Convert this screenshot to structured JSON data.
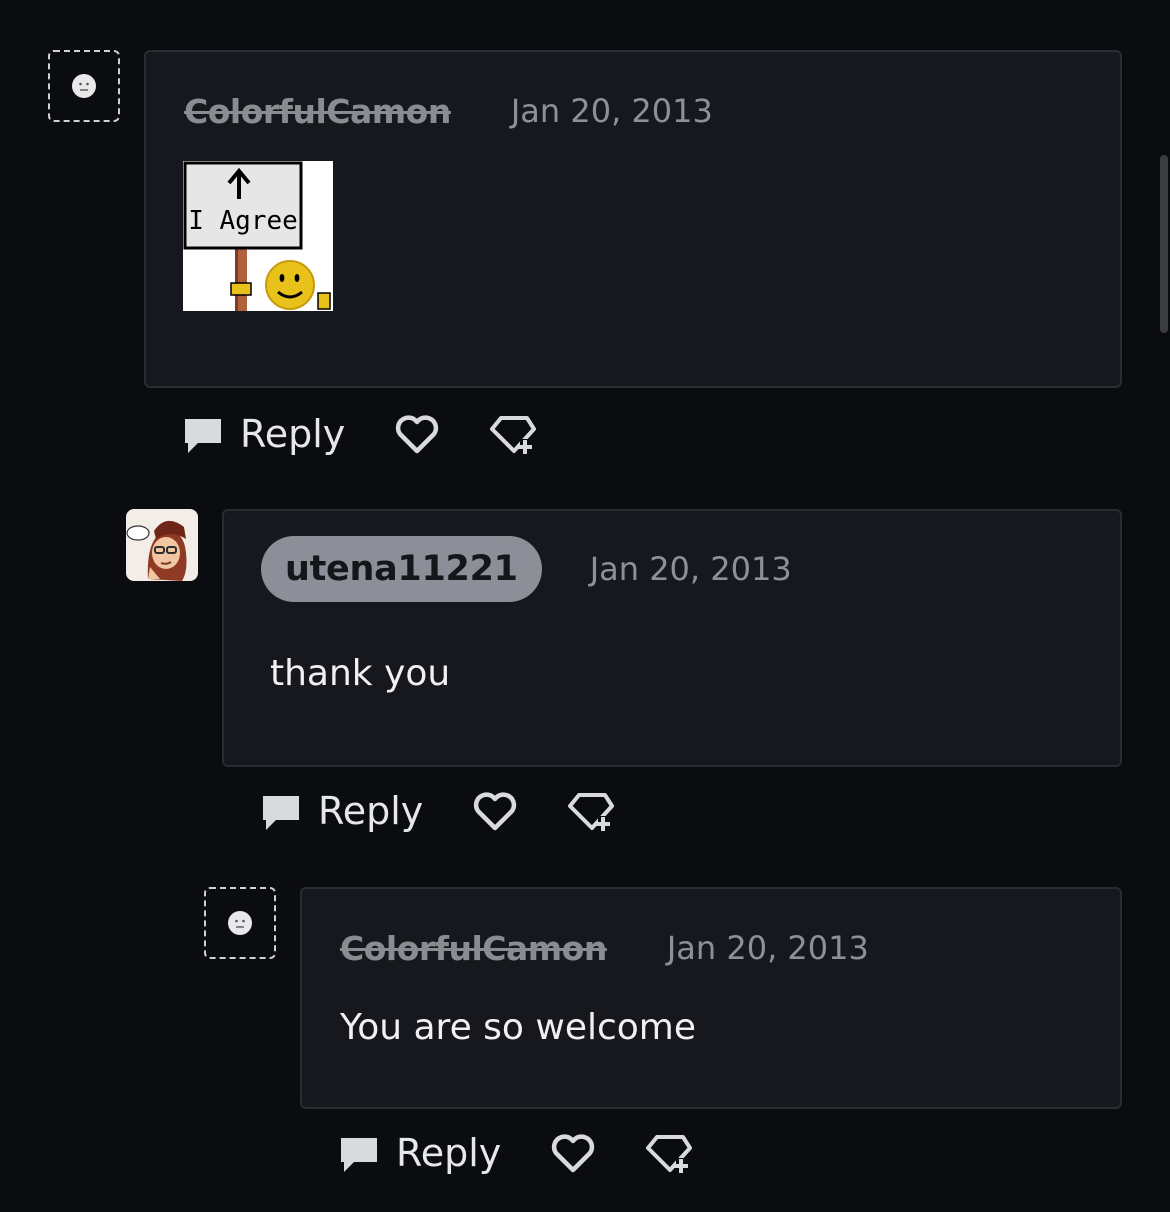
{
  "comments": [
    {
      "username": "ColorfulCamon",
      "date": "Jan 20, 2013",
      "image_sign_text": "I Agree",
      "actions": {
        "reply_label": "Reply"
      }
    },
    {
      "username": "utena11221",
      "date": "Jan 20, 2013",
      "text": "thank you",
      "actions": {
        "reply_label": "Reply"
      }
    },
    {
      "username": "ColorfulCamon",
      "date": "Jan 20, 2013",
      "text": "You are so welcome",
      "actions": {
        "reply_label": "Reply"
      }
    }
  ],
  "icons": {
    "reply": "speech-bubble-icon",
    "like": "heart-icon",
    "award": "gem-plus-icon",
    "deleted_avatar": "face-icon"
  },
  "colors": {
    "background": "#0b0c10",
    "card": "#16181d",
    "card_border": "#2a2c33",
    "muted_text": "#8e9098",
    "username_pill": "#8d8f98"
  }
}
